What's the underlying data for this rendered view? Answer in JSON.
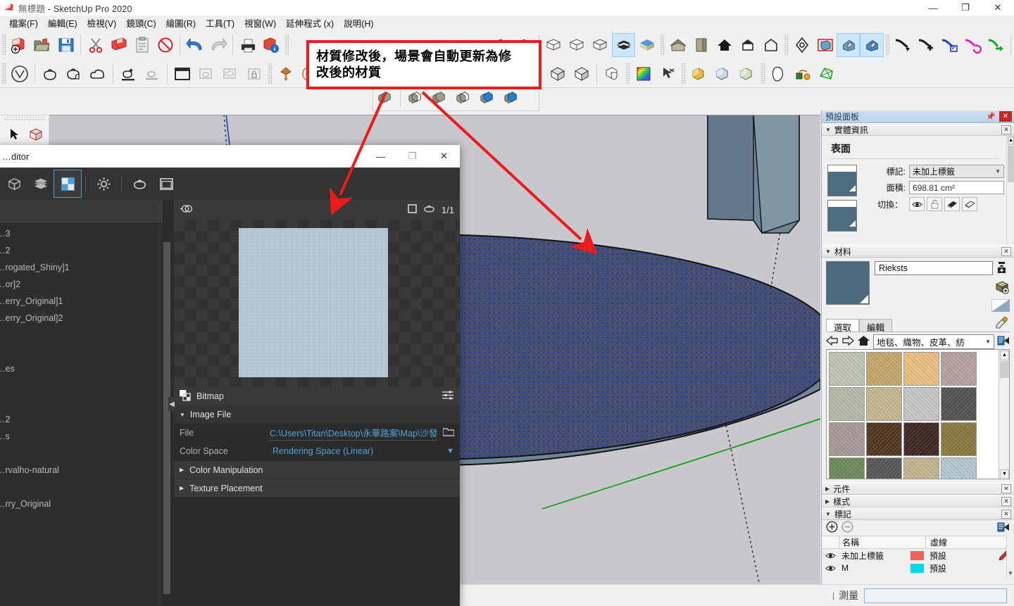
{
  "window": {
    "title_doc": "無標題",
    "title_app": " - SketchUp Pro 2020",
    "minimize": "—",
    "maximize": "❐",
    "close": "✕",
    "app_icon": "sketchup-logo-icon"
  },
  "menubar": {
    "items": [
      {
        "label": "檔案(F)",
        "name": "menu-file"
      },
      {
        "label": "編輯(E)",
        "name": "menu-edit"
      },
      {
        "label": "檢視(V)",
        "name": "menu-view"
      },
      {
        "label": "鏡頭(C)",
        "name": "menu-camera"
      },
      {
        "label": "繪圖(R)",
        "name": "menu-draw"
      },
      {
        "label": "工具(T)",
        "name": "menu-tools"
      },
      {
        "label": "視窗(W)",
        "name": "menu-window"
      },
      {
        "label": "延伸程式 (x)",
        "name": "menu-extensions"
      },
      {
        "label": "說明(H)",
        "name": "menu-help"
      }
    ]
  },
  "annotation": {
    "line1": "材質修改後，場景會自動更新為修",
    "line2": "改後的材質",
    "border_color": "#ee1b1b"
  },
  "toolbar_row1": [
    {
      "name": "new-icon",
      "label": "新增"
    },
    {
      "name": "open-icon",
      "label": "開啟"
    },
    {
      "name": "save-icon",
      "label": "儲存"
    },
    {
      "name": "cut-icon",
      "label": "剪下"
    },
    {
      "name": "copy-icon",
      "label": "複製"
    },
    {
      "name": "paste-icon",
      "label": "貼上"
    },
    {
      "name": "erase-icon",
      "label": "刪除"
    },
    {
      "name": "undo-icon",
      "label": "復原"
    },
    {
      "name": "redo-icon",
      "label": "重做"
    },
    {
      "name": "print-icon",
      "label": "列印"
    },
    {
      "name": "model-info-icon",
      "label": "模型資訊"
    }
  ],
  "toolbar_row2": [
    {
      "name": "vray-render-icon",
      "label": "Render"
    },
    {
      "name": "vray-asset-editor-icon",
      "label": "Asset Editor"
    },
    {
      "name": "vray-interactive-render-icon",
      "label": "Interactive"
    },
    {
      "name": "vray-cloud-icon",
      "label": "Cloud"
    },
    {
      "name": "vray-render-last-icon",
      "label": "Render Last"
    },
    {
      "name": "vray-frame-buffer-icon",
      "label": "Frame Buffer"
    },
    {
      "name": "vray-batch-render-icon",
      "label": "Batch"
    },
    {
      "name": "vray-lock-icon",
      "label": "Lock"
    }
  ],
  "material_editor": {
    "title": "…ditor",
    "minimize": "—",
    "maximize": "❐",
    "close": "✕",
    "toolbar_icons": [
      {
        "name": "geometry-icon"
      },
      {
        "name": "lights-icon"
      },
      {
        "name": "materials-icon",
        "active": true
      },
      {
        "name": "settings-gear-icon"
      },
      {
        "name": "render-teapot-icon"
      },
      {
        "name": "frame-buffer-icon"
      }
    ],
    "preview": {
      "left_icon": "visibility-toggle-icon",
      "right_icons": [
        "square-icon",
        "teapot-icon"
      ],
      "zoom_label": "1/1",
      "texture_color": "#b4c6d2"
    },
    "material_list": [
      {
        "label": "…3"
      },
      {
        "label": "…2"
      },
      {
        "label": "…rogated_Shiny]1"
      },
      {
        "label": "…or]2"
      },
      {
        "label": "…erry_Original]1"
      },
      {
        "label": "…erry_Original]2"
      },
      {
        "label": ""
      },
      {
        "label": ""
      },
      {
        "label": "…es"
      },
      {
        "label": ""
      },
      {
        "label": ""
      },
      {
        "label": "…2"
      },
      {
        "label": "…s"
      },
      {
        "label": ""
      },
      {
        "label": "…rvalho-natural"
      },
      {
        "label": ""
      },
      {
        "label": "…rry_Original"
      }
    ],
    "sections": {
      "bitmap_title": "Bitmap",
      "bitmap_icon": "bitmap-icon",
      "bitmap_options_icon": "sliders-icon",
      "image_file_title": "Image File",
      "file_label": "File",
      "file_value": "C:\\Users\\Titan\\Desktop\\永華路案\\Map\\沙發...",
      "folder_icon": "folder-open-icon",
      "color_space_label": "Color Space",
      "color_space_value": "Rendering Space (Linear)",
      "color_manipulation": "Color Manipulation",
      "texture_placement": "Texture Placement"
    }
  },
  "tray": {
    "title": "預設面板",
    "pin_icon": "pin-icon",
    "close_icon": "close-icon",
    "entity_info": {
      "title": "實體資訊",
      "heading": "表面",
      "tag_label": "標記:",
      "tag_value": "未加上標籤",
      "area_label": "面積:",
      "area_value": "698.81 cm²",
      "toggle_label": "切換：",
      "toggles": [
        {
          "name": "eye-visible-icon",
          "on": true
        },
        {
          "name": "unlock-icon",
          "on": false
        },
        {
          "name": "front-face-icon",
          "on": true
        },
        {
          "name": "back-face-icon",
          "on": true
        }
      ],
      "swatch_color": "#4e6e80"
    },
    "materials": {
      "title": "材料",
      "name_value": "Rieksts",
      "create_icon": "create-material-icon",
      "sample_icon": "add-sample-icon",
      "preview_icon": "preview-triangle-icon",
      "tabs": [
        {
          "label": "選取",
          "selected": true,
          "name": "tab-select"
        },
        {
          "label": "編輯",
          "selected": false,
          "name": "tab-edit"
        }
      ],
      "eyedropper_icon": "eyedropper-icon",
      "nav": {
        "back_icon": "arrow-back-icon",
        "forward_icon": "arrow-forward-icon",
        "home_icon": "home-icon",
        "library_value": "地毯、織物、皮革、紡",
        "details_icon": "details-menu-icon"
      },
      "swatches": [
        "#c2c8b5",
        "#c6aa6a",
        "#f0c183",
        "#b9a2a0",
        "#b8bda9",
        "#cbb98f",
        "#c8cbca",
        "#4f5152",
        "#a99b99",
        "#52331a",
        "#3b2320",
        "#8a7a3a",
        "#6f8a5a",
        "#555555",
        "#c8b68e",
        "#b7cbd4"
      ]
    },
    "components": {
      "title": "元件"
    },
    "styles": {
      "title": "樣式"
    },
    "tags": {
      "title": "標記",
      "add_icon": "plus-circle-icon",
      "remove_icon": "minus-circle-icon",
      "details_icon": "tags-details-icon",
      "columns": [
        "名稱",
        "虛線"
      ],
      "rows": [
        {
          "visible_icon": "eye-icon",
          "name": "未加上標籤",
          "color": "#f4605c",
          "dash": "預設"
        },
        {
          "visible_icon": "eye-icon",
          "name": "M",
          "color": "#00d7f0",
          "dash": "預設"
        }
      ],
      "edit_icon": "pencil-icon"
    }
  },
  "status_bar": {
    "measure_label": "測量",
    "measure_value": ""
  },
  "left_tools": [
    {
      "name": "select-arrow-icon"
    },
    {
      "name": "component-box-icon"
    }
  ],
  "viewport": {
    "background_color": "#c7c7cd",
    "selected_face_color": "#46516f",
    "fabric_color": "#6e8593"
  }
}
